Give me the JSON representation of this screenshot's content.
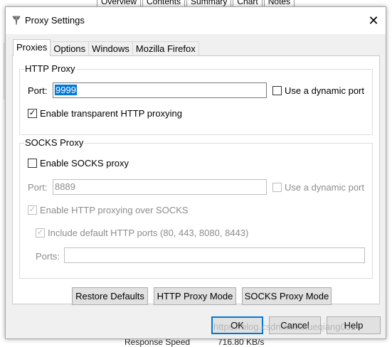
{
  "background": {
    "tabs": [
      "Overview",
      "Contents",
      "Summary",
      "Chart",
      "Notes"
    ],
    "bottom_label": "Response Speed",
    "bottom_value": "716.80 KB/s"
  },
  "dialog": {
    "title": "Proxy Settings",
    "tabs": [
      "Proxies",
      "Options",
      "Windows",
      "Mozilla Firefox"
    ],
    "active_tab": "Proxies",
    "http_proxy": {
      "group_title": "HTTP Proxy",
      "port_label": "Port:",
      "port_value": "9999",
      "dynamic_port_label": "Use a dynamic port",
      "dynamic_port_checked": false,
      "transparent_label": "Enable transparent HTTP proxying",
      "transparent_checked": true
    },
    "socks_proxy": {
      "group_title": "SOCKS Proxy",
      "enable_label": "Enable SOCKS proxy",
      "enable_checked": false,
      "port_label": "Port:",
      "port_value": "8889",
      "dynamic_port_label": "Use a dynamic port",
      "http_over_socks_label": "Enable HTTP proxying over SOCKS",
      "http_over_socks_checked": true,
      "include_ports_label": "Include default HTTP ports (80, 443, 8080, 8443)",
      "include_ports_checked": true,
      "ports_label": "Ports:",
      "ports_value": ""
    },
    "mode_buttons": {
      "restore": "Restore Defaults",
      "http_mode": "HTTP Proxy Mode",
      "socks_mode": "SOCKS Proxy Mode"
    },
    "footer_buttons": {
      "ok": "OK",
      "cancel": "Cancel",
      "help": "Help"
    }
  },
  "watermark": "https://blog.csdn.net/lixueqiang001",
  "colors": {
    "selection": "#0078d7",
    "dialog_bg": "#f0f0f0",
    "button_bg": "#e1e1e1"
  }
}
